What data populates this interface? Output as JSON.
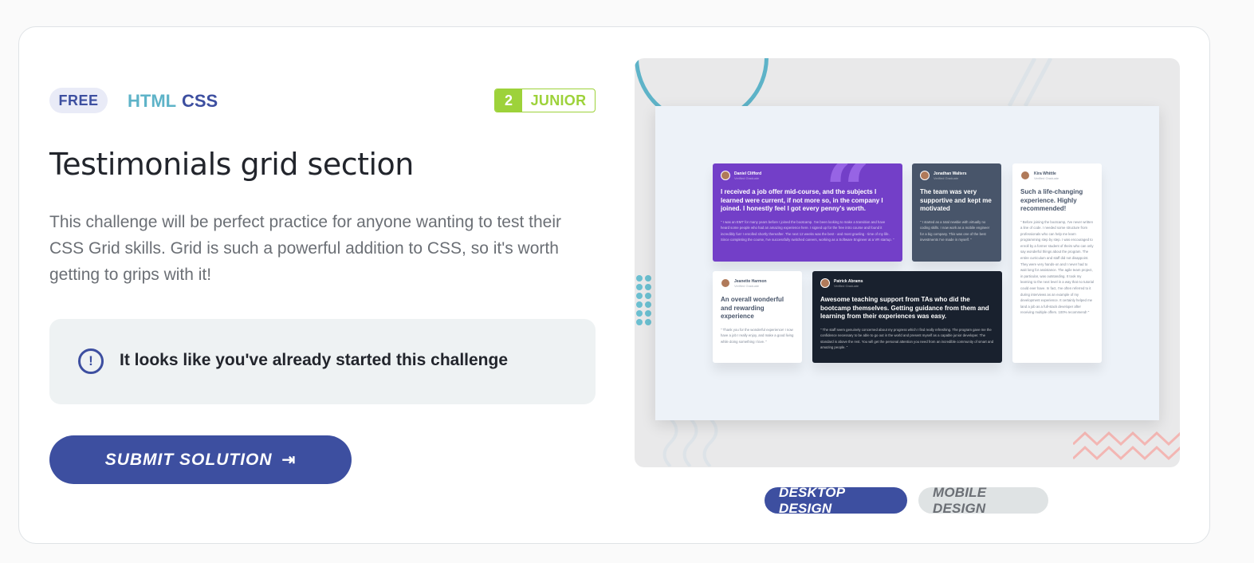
{
  "challenge": {
    "price_tag": "FREE",
    "languages": [
      "HTML",
      "CSS"
    ],
    "level": {
      "number": "2",
      "name": "JUNIOR"
    },
    "title": "Testimonials grid section",
    "description": "This challenge will be perfect practice for anyone wanting to test their CSS Grid skills. Grid is such a powerful addition to CSS, so it's worth getting to grips with it!",
    "notice": "It looks like you've already started this challenge",
    "submit_label": "SUBMIT SOLUTION"
  },
  "preview": {
    "cards": [
      {
        "name": "Daniel Clifford",
        "sub": "Verified Graduate",
        "headline": "I received a job offer mid-course, and the subjects I learned were current, if not more so, in the company I joined. I honestly feel I got every penny's worth.",
        "body": "\" I was an EMT for many years before I joined the bootcamp. I've been looking to make a transition and have heard some people who had an amazing experience here. I signed up for the free intro course and found it incredibly fun! I enrolled shortly thereafter. The next 12 weeks was the best - and most grueling - time of my life. Since completing the course, I've successfully switched careers, working as a Software Engineer at a VR startup. \""
      },
      {
        "name": "Jonathan Walters",
        "sub": "Verified Graduate",
        "headline": "The team was very supportive and kept me motivated",
        "body": "\" I started as a total newbie with virtually no coding skills. I now work as a mobile engineer for a big company. This was one of the best investments I've made in myself. \""
      },
      {
        "name": "Kira Whittle",
        "sub": "Verified Graduate",
        "headline": "Such a life-changing experience. Highly recommended!",
        "body": "\" Before joining the bootcamp, I've never written a line of code. I needed some structure from professionals who can help me learn programming step by step. I was encouraged to enroll by a former student of theirs who can only say wonderful things about the program. The entire curriculum and staff did not disappoint. They were very hands-on and I never had to wait long for assistance. The agile team project, in particular, was outstanding. It took my learning to the next level in a way that no tutorial could ever have. In fact, I've often referred to it during interviews as an example of my development experience. It certainly helped me land a job as a full-stack developer after receiving multiple offers. 100% recommend! \""
      },
      {
        "name": "Jeanette Harmon",
        "sub": "Verified Graduate",
        "headline": "An overall wonderful and rewarding experience",
        "body": "\" Thank you for the wonderful experience! I now have a job I really enjoy, and make a good living while doing something I love. \""
      },
      {
        "name": "Patrick Abrams",
        "sub": "Verified Graduate",
        "headline": "Awesome teaching support from TAs who did the bootcamp themselves. Getting guidance from them and learning from their experiences was easy.",
        "body": "\" The staff seem genuinely concerned about my progress which I find really refreshing. The program gave me the confidence necessary to be able to go out in the world and present myself as a capable junior developer. The standard is above the rest. You will get the personal attention you need from an incredible community of smart and amazing people. \""
      }
    ]
  },
  "design_tabs": {
    "desktop": "DESKTOP DESIGN",
    "mobile": "MOBILE DESIGN",
    "selected": "desktop"
  },
  "colors": {
    "brand_blue": "#3d4fa0",
    "html_teal": "#5eb3c8",
    "junior_green": "#9dd23a",
    "card_purple": "#733fc8",
    "card_slate": "#48556a",
    "card_dark": "#19212e"
  },
  "icons": {
    "notice": "exclamation-circle-icon",
    "submit": "sign-in-arrow-icon"
  }
}
